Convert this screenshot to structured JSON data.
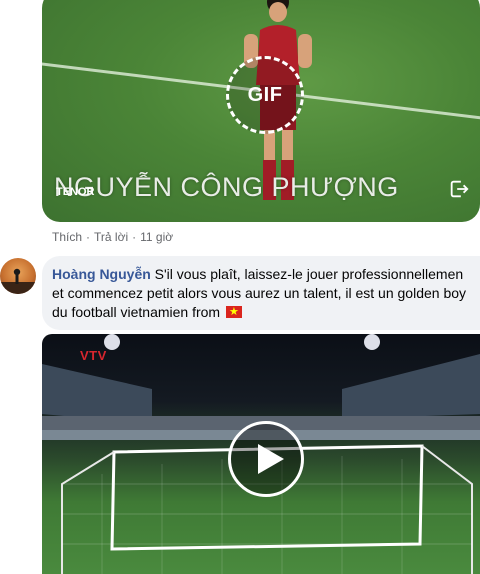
{
  "gif": {
    "badge_label": "GIF",
    "caption": "NGUYỄN CÔNG PHƯỢNG",
    "source_label": "TENOR"
  },
  "actions": {
    "like": "Thích",
    "separator": "·",
    "reply": "Trả lời",
    "time": "11 giờ"
  },
  "comment": {
    "author": "Hoàng Nguyễn",
    "line1": "S'il vous plaît, laissez-le jouer professionnellemen",
    "line2": "et commencez petit alors vous aurez un talent, il est un golden boy",
    "line3": "du football vietnamien from"
  },
  "video": {
    "channel_logo": "VTV"
  },
  "colors": {
    "author": "#385898",
    "meta": "#65676b",
    "bubble": "#f0f2f5"
  }
}
